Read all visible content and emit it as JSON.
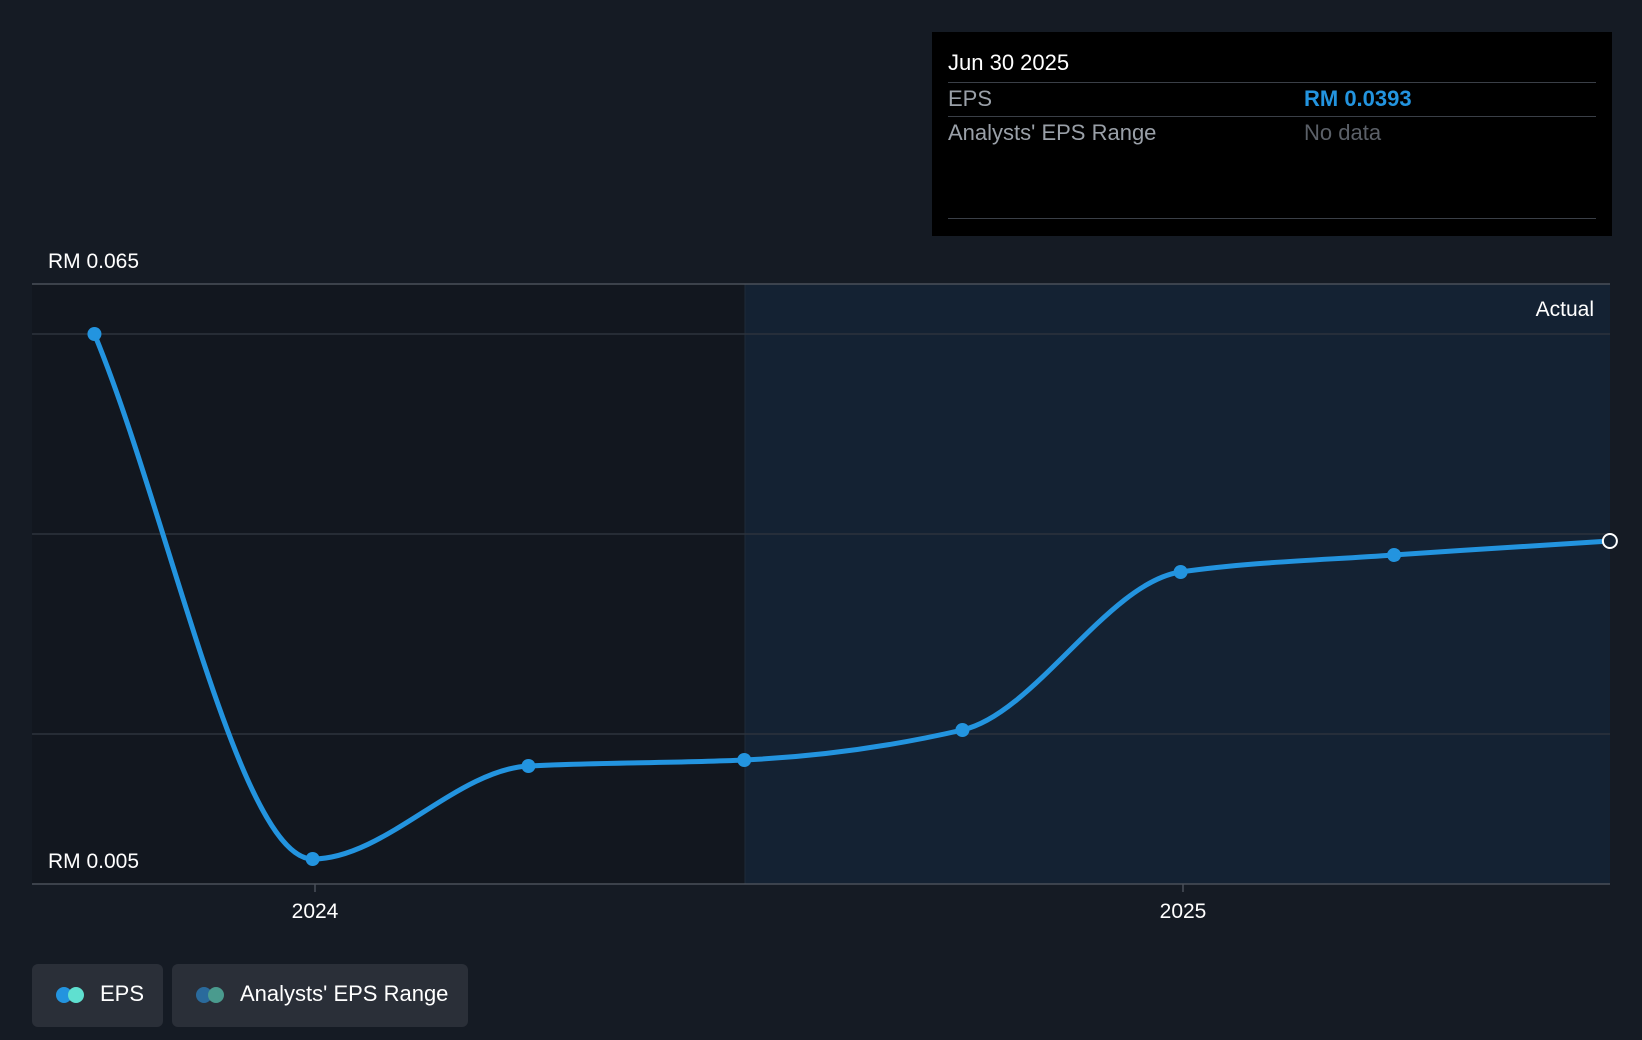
{
  "chart_data": {
    "type": "line",
    "y_axis": {
      "top_label": "RM 0.065",
      "bottom_label": "RM 0.005",
      "ylim": [
        0.005,
        0.065
      ]
    },
    "x_axis": {
      "tick_labels": [
        "2024",
        "2025"
      ],
      "tick_dates": [
        "2024-01-01",
        "2025-01-01"
      ]
    },
    "region_label": "Actual",
    "series": [
      {
        "name": "EPS",
        "color": "#2394df",
        "points": [
          {
            "date": "2023-09-30",
            "value": 0.06
          },
          {
            "date": "2023-12-31",
            "value": 0.0075
          },
          {
            "date": "2024-03-31",
            "value": 0.0168
          },
          {
            "date": "2024-06-30",
            "value": 0.0174
          },
          {
            "date": "2024-09-30",
            "value": 0.0204
          },
          {
            "date": "2024-12-31",
            "value": 0.0362
          },
          {
            "date": "2025-03-31",
            "value": 0.0379
          },
          {
            "date": "2025-06-30",
            "value": 0.0393
          }
        ]
      }
    ],
    "grid": true
  },
  "tooltip": {
    "date": "Jun 30 2025",
    "rows": [
      {
        "label": "EPS",
        "value": "RM 0.0393"
      },
      {
        "label": "Analysts' EPS Range",
        "value": "No data"
      }
    ]
  },
  "legend": [
    {
      "label": "EPS",
      "colors": [
        "#2394df",
        "#5fe0d0"
      ]
    },
    {
      "label": "Analysts' EPS Range",
      "colors": [
        "#2a6a9c",
        "#4a9b8e"
      ]
    }
  ]
}
